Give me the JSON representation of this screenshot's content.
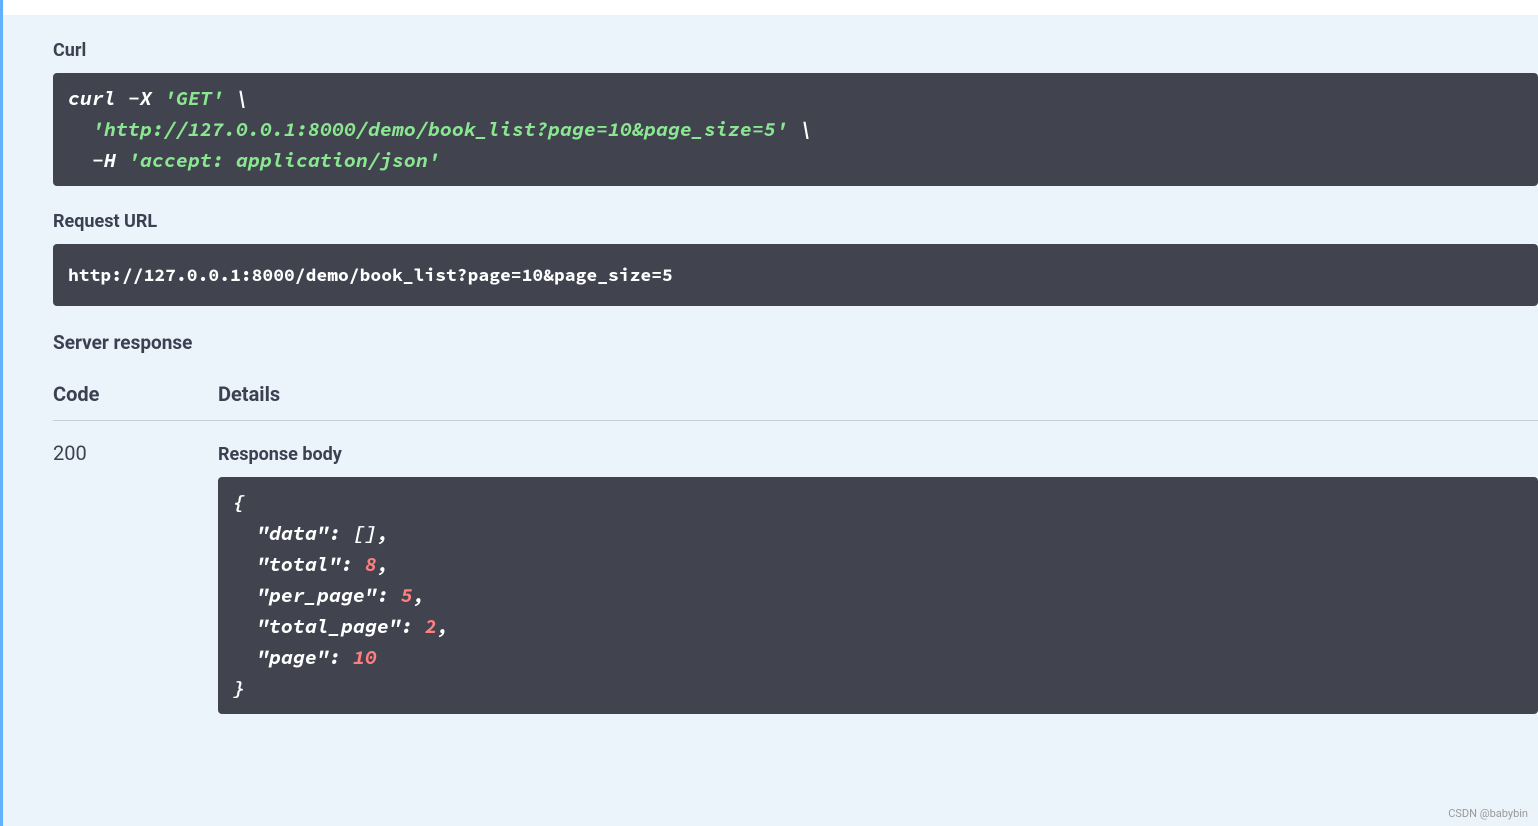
{
  "labels": {
    "curl": "Curl",
    "request_url": "Request URL",
    "server_response": "Server response",
    "code": "Code",
    "details": "Details",
    "response_body": "Response body"
  },
  "curl": {
    "line1_pre": "curl -X ",
    "line1_method": "'GET'",
    "line1_post": " \\",
    "line2_indent": "  ",
    "line2_url": "'http://127.0.0.1:8000/demo/book_list?page=10&page_size=5'",
    "line2_post": " \\",
    "line3_indent": "  -H ",
    "line3_header": "'accept: application/json'"
  },
  "request_url": "http://127.0.0.1:8000/demo/book_list?page=10&page_size=5",
  "response": {
    "code": "200",
    "body": {
      "open": "{",
      "line_data_key": "  \"data\"",
      "line_data_val": ": [],",
      "line_total_key": "  \"total\"",
      "line_total_sep": ": ",
      "line_total_val": "8",
      "line_total_end": ",",
      "line_perpage_key": "  \"per_page\"",
      "line_perpage_sep": ": ",
      "line_perpage_val": "5",
      "line_perpage_end": ",",
      "line_totalpage_key": "  \"total_page\"",
      "line_totalpage_sep": ": ",
      "line_totalpage_val": "2",
      "line_totalpage_end": ",",
      "line_page_key": "  \"page\"",
      "line_page_sep": ": ",
      "line_page_val": "10",
      "close": "}"
    }
  },
  "watermark": "CSDN @babybin"
}
